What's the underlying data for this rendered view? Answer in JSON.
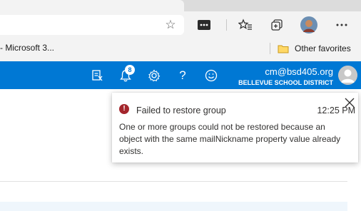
{
  "browser": {
    "favorites_bar": {
      "partial_item_label": "- Microsoft 3...",
      "other_favorites_label": "Other favorites"
    },
    "toolbar_icons": [
      "star-icon",
      "extension-icon",
      "favorites-icon",
      "collections-icon",
      "profile-avatar",
      "more-icon"
    ]
  },
  "header": {
    "notification_count": "8",
    "account_email": "cm@bsd405.org",
    "account_org": "BELLEVUE SCHOOL DISTRICT",
    "icons": [
      "admin-app-icon",
      "notification-bell-icon",
      "settings-gear-icon",
      "help-icon",
      "feedback-smiley-icon"
    ],
    "accent_color": "#0078d4"
  },
  "toast": {
    "title": "Failed to restore group",
    "time": "12:25 PM",
    "message": "One or more groups could not be restored because an object with the same mailNickname property value already exists.",
    "status_color": "#a4262c"
  }
}
